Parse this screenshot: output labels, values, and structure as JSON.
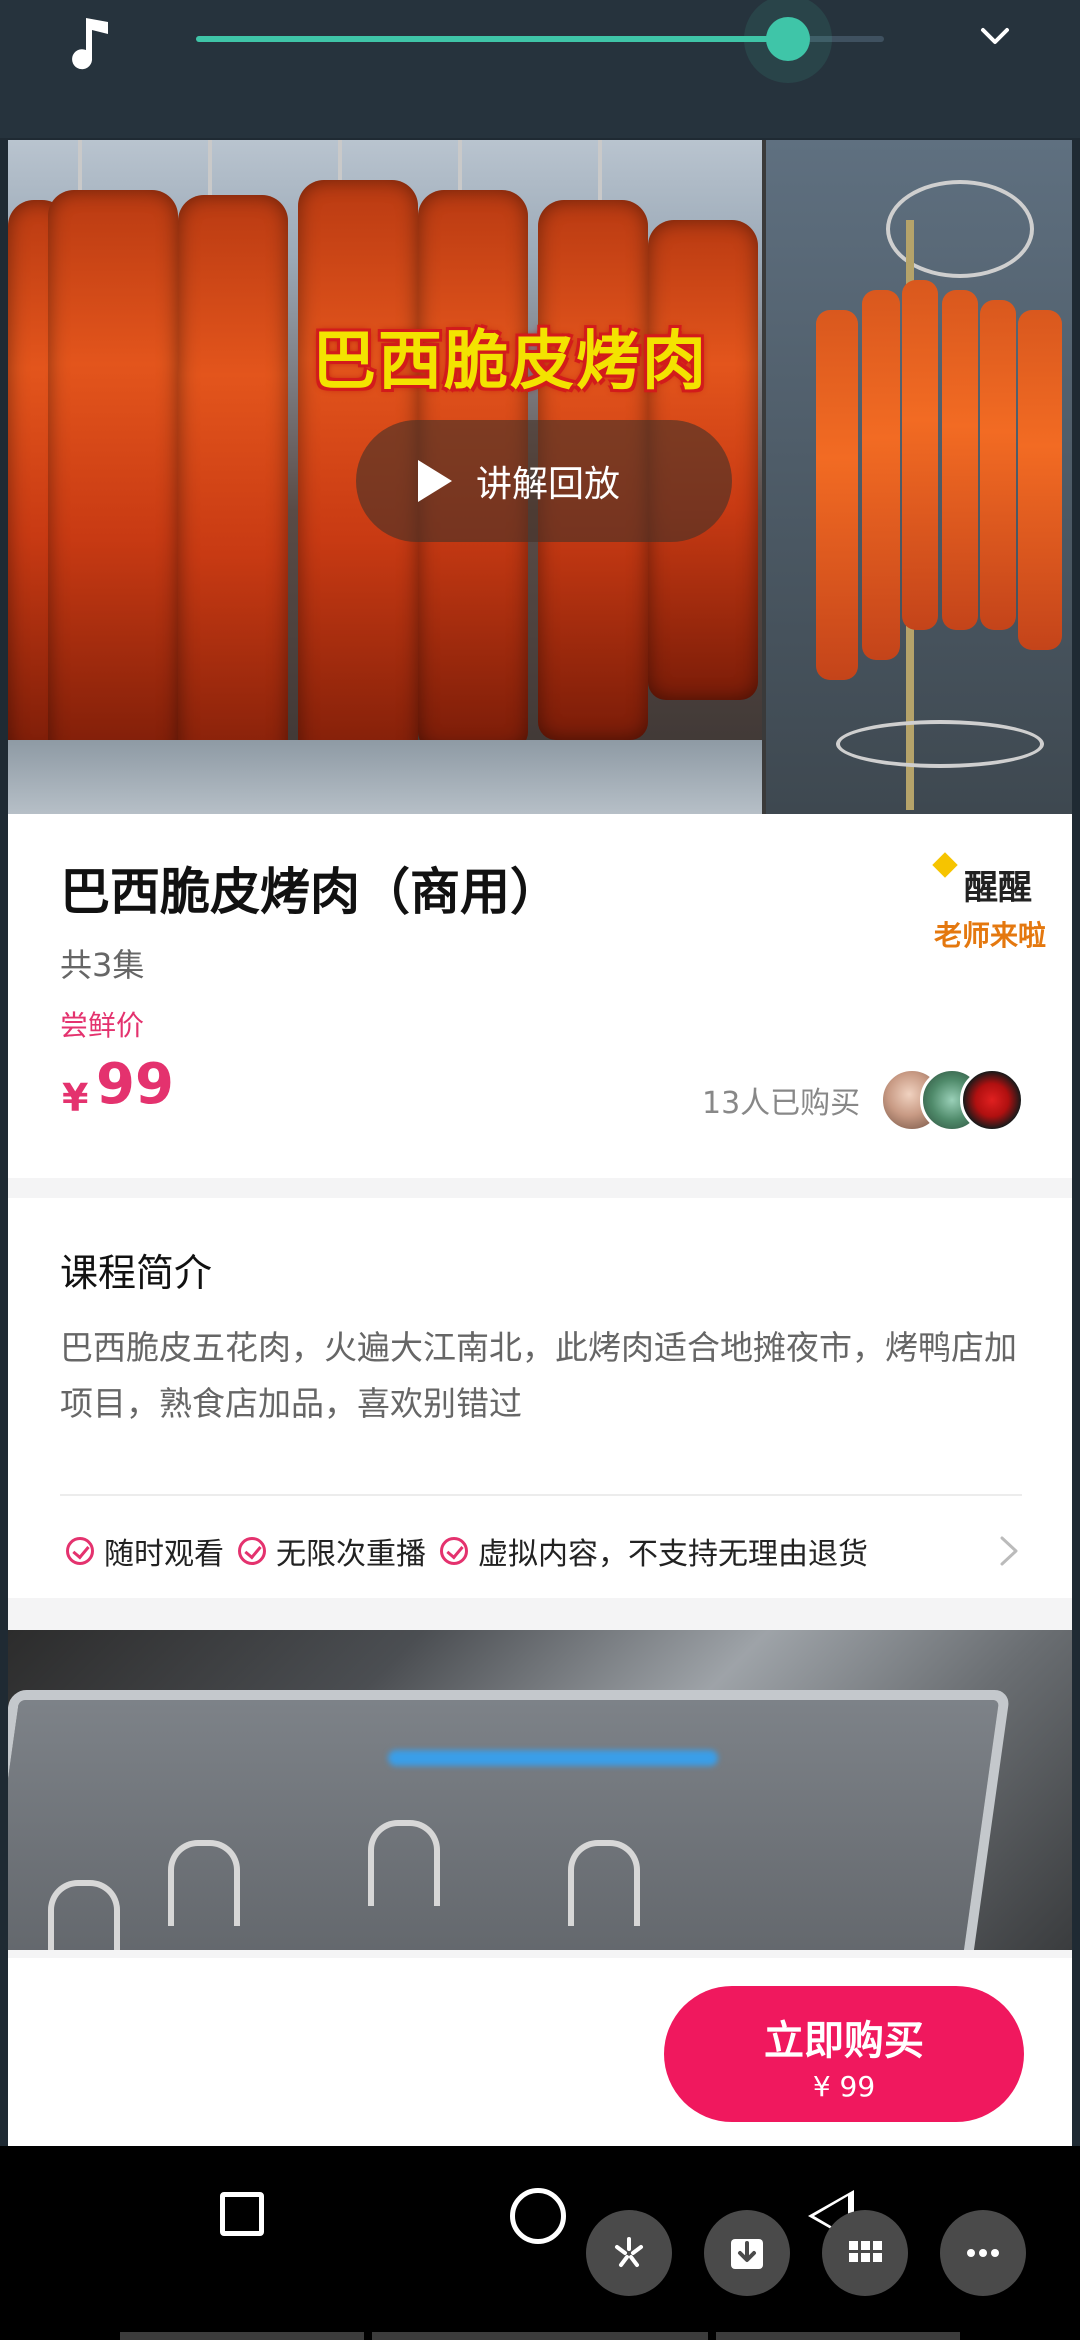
{
  "media_bar": {
    "progress": 0.86
  },
  "hero": {
    "overlay_title": "巴西脆皮烤肉",
    "replay_label": "讲解回放"
  },
  "course": {
    "title": "巴西脆皮烤肉（商用）",
    "episodes": "共3集",
    "price_label": "尝鲜价",
    "price_symbol": "¥",
    "price_value": "99",
    "buyers": "13人已购买",
    "brand_line1": "醒醒",
    "brand_line2": "老师来啦"
  },
  "description": {
    "title": "课程简介",
    "text": "巴西脆皮五花肉，火遍大江南北，此烤肉适合地摊夜市，烤鸭店加项目，熟食店加品，喜欢别错过",
    "features": [
      "随时观看",
      "无限次重播",
      "虚拟内容，不支持无理由退货"
    ]
  },
  "buy": {
    "label": "立即购买",
    "price": "¥ 99"
  },
  "colors": {
    "accent": "#e4326e",
    "buy_button": "#f0185e",
    "slider": "#3fc5a8"
  }
}
